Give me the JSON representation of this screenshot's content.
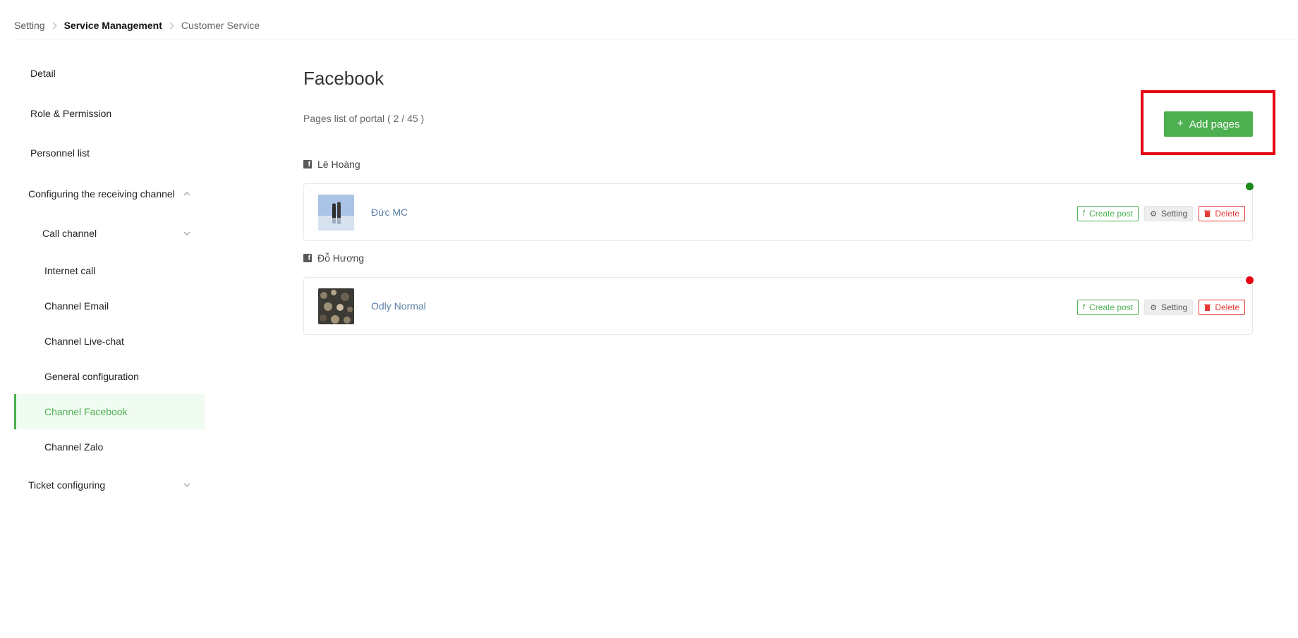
{
  "breadcrumb": {
    "items": [
      "Setting",
      "Service Management",
      "Customer Service"
    ]
  },
  "sidebar": {
    "items": [
      {
        "label": "Detail"
      },
      {
        "label": "Role & Permission"
      },
      {
        "label": "Personnel list"
      },
      {
        "label": "Configuring the receiving channel",
        "chevron": "chevron-up-icon"
      },
      {
        "label": "Call channel",
        "chevron": "chevron-down-icon"
      },
      {
        "label": "Internet call"
      },
      {
        "label": "Channel Email"
      },
      {
        "label": "Channel Live-chat"
      },
      {
        "label": "General configuration"
      },
      {
        "label": "Channel Facebook",
        "active": true
      },
      {
        "label": "Channel Zalo"
      },
      {
        "label": "Ticket configuring",
        "chevron": "chevron-down-icon"
      }
    ]
  },
  "main": {
    "title": "Facebook",
    "subtitle": "Pages list of portal ( 2 / 45 )",
    "add_button": {
      "label": "Add pages",
      "icon": "plus-icon"
    },
    "groups": [
      {
        "account": "Lê Hoàng",
        "pages": [
          {
            "name": "Đức MC",
            "status_color": "#1a8a1a"
          }
        ]
      },
      {
        "account": "Đỗ Hương",
        "pages": [
          {
            "name": "Odly Normal",
            "status_color": "#e60012"
          }
        ]
      }
    ],
    "actions": {
      "create_post": "Create post",
      "setting": "Setting",
      "delete": "Delete"
    }
  },
  "colors": {
    "accent": "#4caf50",
    "danger": "#e53935",
    "highlight_box": "#e60012",
    "link": "#5b7fa6"
  }
}
